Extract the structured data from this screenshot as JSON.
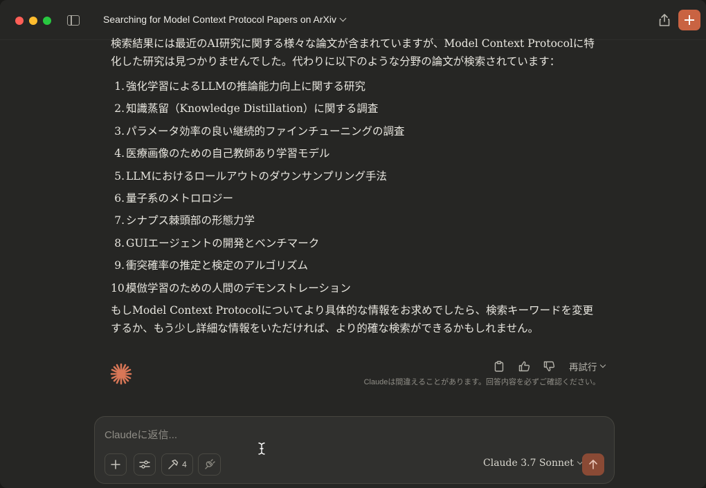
{
  "window": {
    "title": "Searching for Model Context Protocol Papers on ArXiv"
  },
  "colors": {
    "accent": "#c96342",
    "background": "#262624",
    "composer": "#30302e",
    "send_button": "#8a4a35"
  },
  "message": {
    "intro": "検索結果には最近のAI研究に関する様々な論文が含まれていますが、Model Context Protocolに特化した研究は見つかりませんでした。代わりに以下のような分野の論文が検索されています：",
    "items": [
      {
        "num": "1.",
        "text": "強化学習によるLLMの推論能力向上に関する研究"
      },
      {
        "num": "2.",
        "text": "知識蒸留（Knowledge Distillation）に関する調査"
      },
      {
        "num": "3.",
        "text": "パラメータ効率の良い継続的ファインチューニングの調査"
      },
      {
        "num": "4.",
        "text": "医療画像のための自己教師あり学習モデル"
      },
      {
        "num": "5.",
        "text": "LLMにおけるロールアウトのダウンサンプリング手法"
      },
      {
        "num": "6.",
        "text": "量子系のメトロロジー"
      },
      {
        "num": "7.",
        "text": "シナプス棘頭部の形態力学"
      },
      {
        "num": "8.",
        "text": "GUIエージェントの開発とベンチマーク"
      },
      {
        "num": "9.",
        "text": "衝突確率の推定と検定のアルゴリズム"
      },
      {
        "num": "10.",
        "text": "模倣学習のための人間のデモンストレーション"
      }
    ],
    "outro": "もしModel Context Protocolについてより具体的な情報をお求めでしたら、検索キーワードを変更するか、もう少し詳細な情報をいただければ、より的確な検索ができるかもしれません。"
  },
  "actions": {
    "retry_label": "再試行",
    "disclaimer": "Claudeは間違えることがあります。回答内容を必ずご確認ください。"
  },
  "composer": {
    "placeholder": "Claudeに返信...",
    "tools_count": "4",
    "model": "Claude 3.7 Sonnet"
  }
}
